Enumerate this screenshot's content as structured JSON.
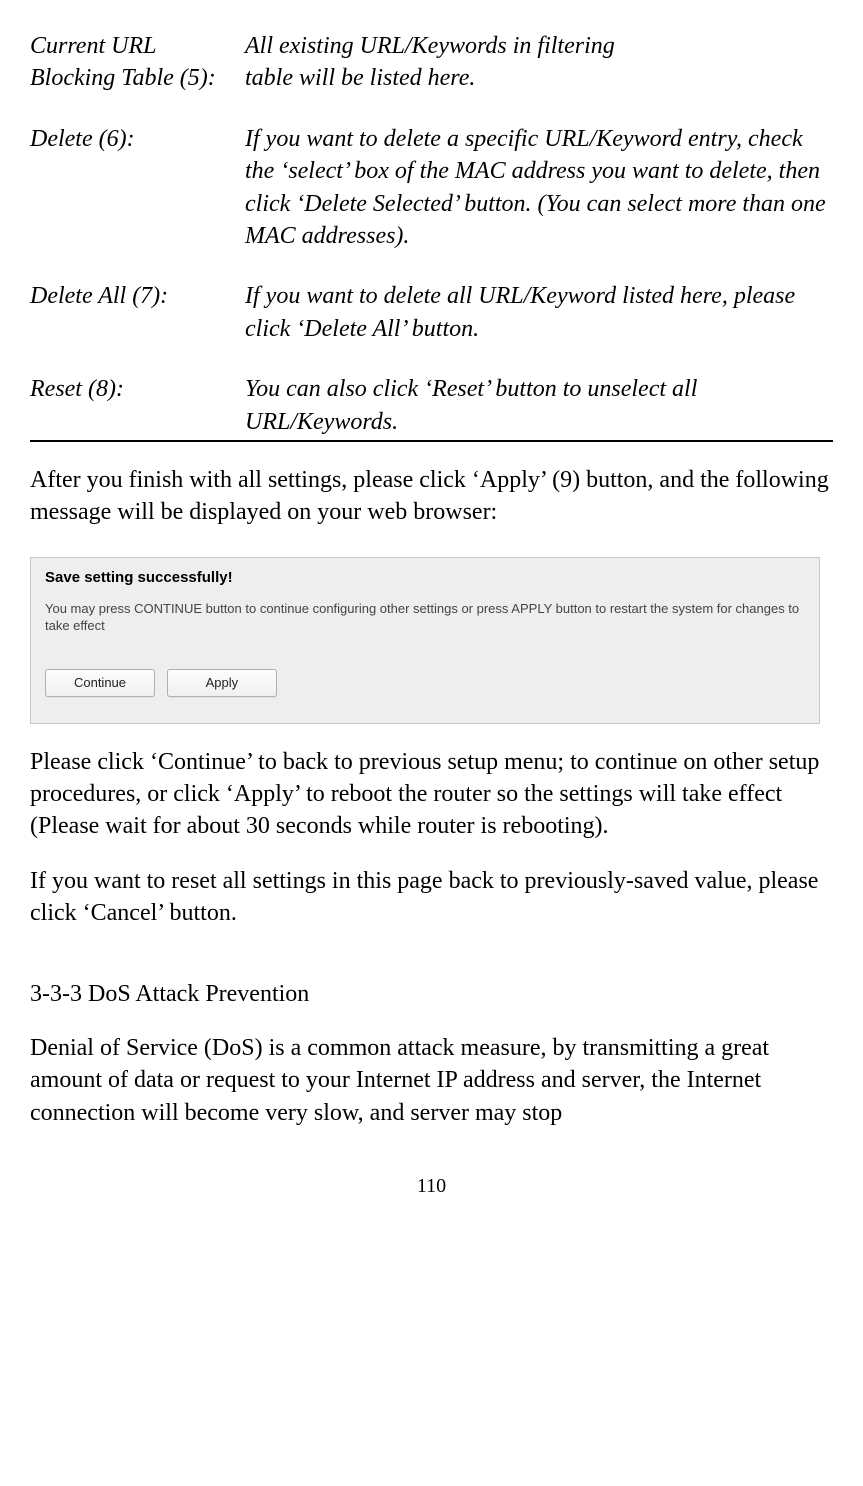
{
  "definitions": {
    "row1_term_line1": "Current URL",
    "row1_term_line2": "Blocking Table (5):",
    "row1_desc_line1": "All existing URL/Keywords in filtering",
    "row1_desc_line2": "table will be listed here.",
    "row2_term": "Delete (6):",
    "row2_desc": "If you want to delete a specific URL/Keyword entry, check the ‘select’ box of the MAC address you want to delete, then click ‘Delete Selected’ button. (You can select more than one MAC addresses).",
    "row3_term": "Delete All (7):",
    "row3_desc": "If you want to delete all URL/Keyword listed here, please click ‘Delete All’ button.",
    "row4_term": "Reset (8):",
    "row4_desc": "You can also click ‘Reset’ button to unselect all URL/Keywords."
  },
  "para_after_table": "After you finish with all settings, please click ‘Apply’ (9) button, and the following message will be displayed on your web browser:",
  "screenshot": {
    "title": "Save setting successfully!",
    "text": "You may press CONTINUE button to continue configuring other settings or press APPLY button to restart the system for changes to take effect",
    "continue_btn": "Continue",
    "apply_btn": "Apply"
  },
  "para_continue": "Please click ‘Continue’ to back to previous setup menu; to continue on other setup procedures, or click ‘Apply’ to reboot the router so the settings will take effect (Please wait for about 30 seconds while router is rebooting).",
  "para_cancel": "If you want to reset all settings in this page back to previously-saved value, please click ‘Cancel’ button.",
  "section_heading": "3-3-3 DoS Attack Prevention",
  "para_dos": "Denial of Service (DoS) is a common attack measure, by transmitting a great amount of data or request to your Internet IP address and server, the Internet connection will become very slow, and server may stop",
  "page_number": "110"
}
